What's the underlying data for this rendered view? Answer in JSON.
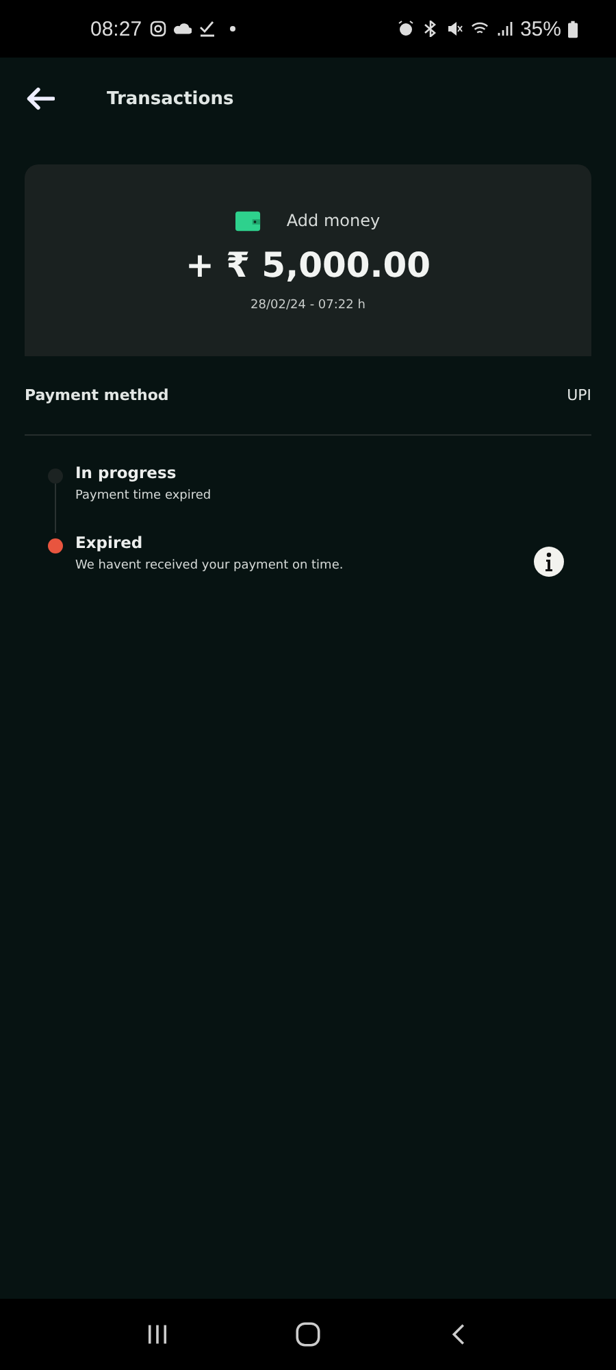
{
  "status_bar": {
    "time": "08:27",
    "battery": "35%"
  },
  "header": {
    "title": "Transactions"
  },
  "card": {
    "label": "Add money",
    "amount": "+ ₹ 5,000.00",
    "date": "28/02/24 - 07:22 h"
  },
  "payment_method": {
    "label": "Payment method",
    "value": "UPI"
  },
  "steps": [
    {
      "title": "In progress",
      "detail": "Payment time expired",
      "color": "#1c2322",
      "info": false
    },
    {
      "title": "Expired",
      "detail": "We havent received your payment on time.",
      "color": "#e8553f",
      "info": true
    }
  ]
}
